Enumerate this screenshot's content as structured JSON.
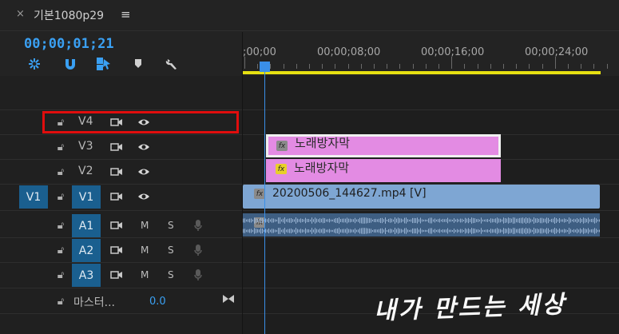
{
  "tab": {
    "close": "×",
    "title": "기본1080p29",
    "menu": "≡"
  },
  "timecode": "00;00;01;21",
  "ruler": {
    "labels": [
      ";00;00",
      "00;00;08;00",
      "00;00;16;00",
      "00;00;24;00"
    ]
  },
  "tracks": {
    "v4": {
      "label": "V4"
    },
    "v3": {
      "label": "V3"
    },
    "v2": {
      "label": "V2"
    },
    "v1": {
      "source": "V1",
      "label": "V1"
    },
    "a1": {
      "label": "A1",
      "m": "M",
      "s": "S"
    },
    "a2": {
      "label": "A2",
      "m": "M",
      "s": "S"
    },
    "a3": {
      "label": "A3",
      "m": "M",
      "s": "S"
    },
    "master": {
      "label": "마스터...",
      "value": "0.0"
    }
  },
  "clips": {
    "v3": {
      "label": "노래방자막",
      "fx": "fx"
    },
    "v2": {
      "label": "노래방자막",
      "fx": "fx"
    },
    "v1": {
      "label": "20200506_144627.mp4 [V]",
      "fx": "fx"
    },
    "a1": {
      "fx": "fx"
    }
  },
  "watermark": "내가 만드는 세상",
  "colors": {
    "accent": "#3aa0f3",
    "highlight": "#e00d0d",
    "workarea": "#e6e012",
    "title_clip": "#e38be3",
    "video_clip": "#7ea6d3",
    "audio_clip": "#3e5e82",
    "track_target": "#1a5f8f"
  }
}
